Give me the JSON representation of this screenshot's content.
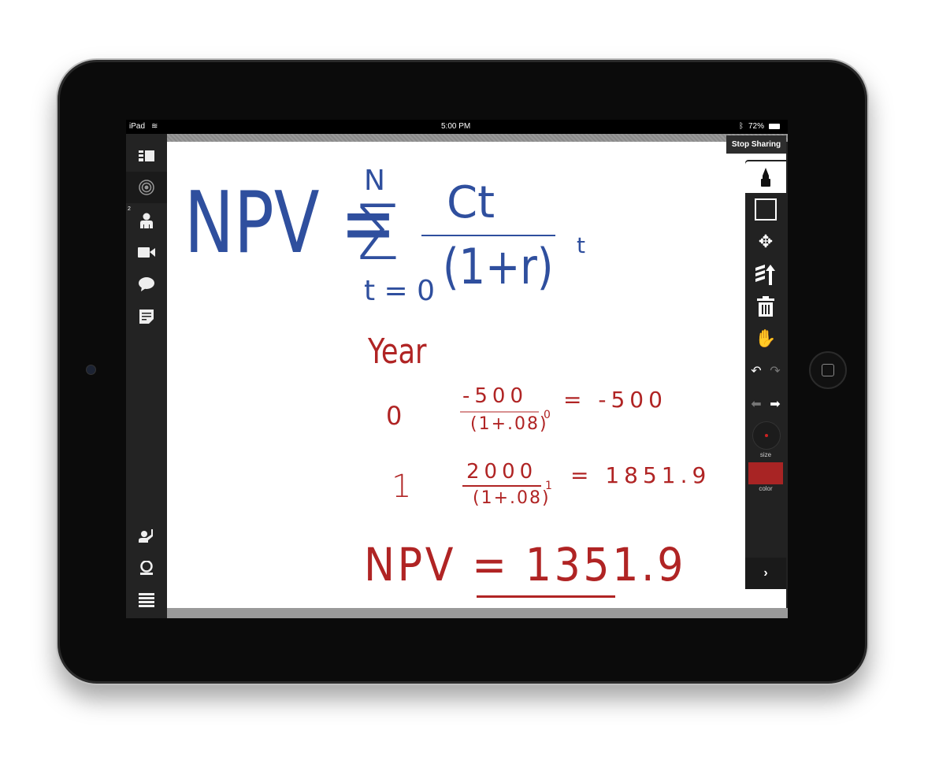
{
  "status_bar": {
    "device": "iPad",
    "time": "5:00 PM",
    "battery": "72%"
  },
  "header": {
    "stop_sharing": "Stop Sharing"
  },
  "sidebar": {
    "participants_badge": "2",
    "items": [
      "panel-toggle",
      "share",
      "participants",
      "video",
      "chat",
      "notes",
      "raise-hand",
      "webcam",
      "menu"
    ]
  },
  "toolbar": {
    "size_label": "size",
    "color_label": "color",
    "pen_color": "#a82424",
    "selected_tool": "pen"
  },
  "whiteboard": {
    "formula": {
      "lhs": "NPV =",
      "sum_upper": "N",
      "sum_symbol": "Σ",
      "sum_lower": "t = 0",
      "numerator": "Ct",
      "denominator": "(1+r)",
      "exponent": "t"
    },
    "year_label": "Year",
    "rows": [
      {
        "year": "0",
        "numerator": "-500",
        "denominator": "(1+.08)",
        "exponent": "0",
        "result": "= -500"
      },
      {
        "year": "1",
        "numerator": "2000",
        "denominator": "(1+.08)",
        "exponent": "1",
        "result": "= 1851.9"
      }
    ],
    "answer": "NPV = 1351.9",
    "colors": {
      "blue_ink": "#2f4f9e",
      "red_ink": "#b02424"
    }
  }
}
